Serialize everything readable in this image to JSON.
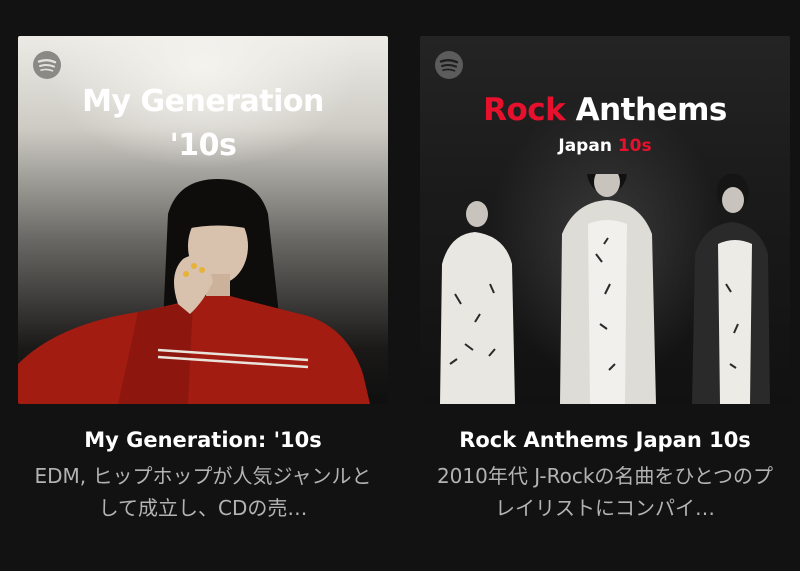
{
  "playlists": [
    {
      "cover_title_line1": "My Generation",
      "cover_title_line2": "'10s",
      "title": "My Generation: '10s",
      "description": "EDM, ヒップホップが人気ジャンルとして成立し、CDの売…",
      "logo_icon": "spotify-icon"
    },
    {
      "cover_title_part1": "Rock",
      "cover_title_part2": " Anthems",
      "cover_subtitle_part1": "Japan ",
      "cover_subtitle_part2": "10s",
      "title": "Rock Anthems Japan 10s",
      "description": "2010年代 J-Rockの名曲をひとつのプレイリストにコンパイ…",
      "logo_icon": "spotify-icon"
    }
  ],
  "colors": {
    "background": "#121212",
    "title_text": "#ffffff",
    "description_text": "#b3b3b3",
    "accent_red": "#e8112d"
  }
}
